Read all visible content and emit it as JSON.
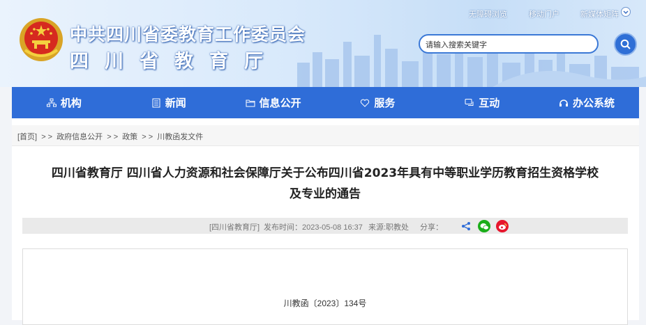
{
  "header": {
    "title": "中共四川省委教育工作委员会",
    "subtitle": "四川省教育厅",
    "top_links": [
      "无障碍浏览",
      "移动门户",
      "新媒体矩阵"
    ],
    "search_placeholder": "请输入搜索关键字"
  },
  "nav": {
    "items": [
      {
        "label": "机构",
        "icon": "org-icon"
      },
      {
        "label": "新闻",
        "icon": "news-icon"
      },
      {
        "label": "信息公开",
        "icon": "folder-icon"
      },
      {
        "label": "服务",
        "icon": "heart-icon"
      },
      {
        "label": "互动",
        "icon": "chat-icon"
      },
      {
        "label": "办公系统",
        "icon": "system-icon"
      }
    ]
  },
  "breadcrumb": {
    "items": [
      "[首页]",
      "政府信息公开",
      "政策",
      "川教函发文件"
    ],
    "separator": "> >"
  },
  "article": {
    "title_line1": "四川省教育厅 四川省人力资源和社会保障厅关于公布四川省2023年具有中等职业学历教育招生资格学校",
    "title_line2": "及专业的通告",
    "source": "[四川省教育厅]",
    "publish_time": "发布时间：2023-05-08 16:37",
    "origin": "来源:职教处",
    "share_label": "分享：",
    "doc_number": "川教函〔2023〕134号"
  },
  "colors": {
    "nav_blue": "#2f6dd8",
    "wechat_green": "#1aad19",
    "weibo_red": "#e6162d",
    "share_blue": "#2f6dd8"
  }
}
